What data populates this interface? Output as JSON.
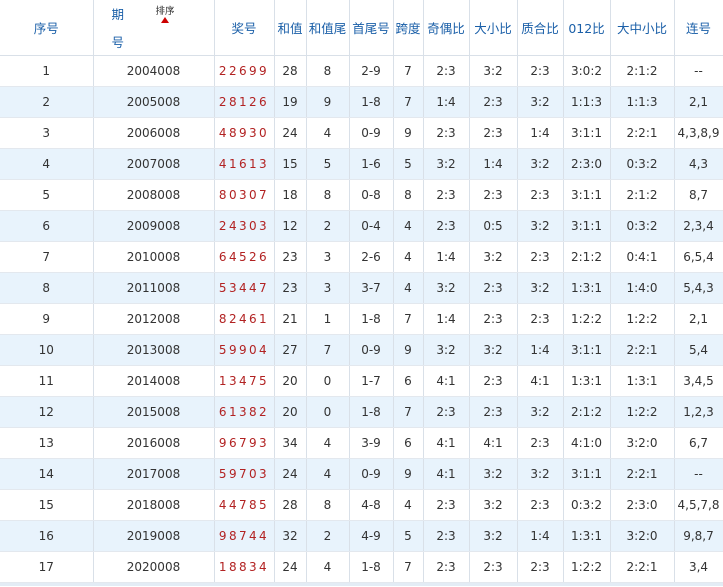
{
  "headers": {
    "seq": "序号",
    "period_1": "期",
    "period_2": "号",
    "sort": "排序",
    "prize": "奖号",
    "sum": "和值",
    "sum_tail": "和值尾",
    "head_tail": "首尾号",
    "span": "跨度",
    "odd_even": "奇偶比",
    "big_small": "大小比",
    "prime_comp": "质合比",
    "r012": "012比",
    "big_mid_small": "大中小比",
    "consecutive": "连号"
  },
  "rows": [
    {
      "seq": "1",
      "period": "2004008",
      "prize": "22699",
      "sum": "28",
      "tail": "8",
      "ht": "2-9",
      "span": "7",
      "oe": "2:3",
      "bs": "3:2",
      "pc": "2:3",
      "r012": "3:0:2",
      "bms": "2:1:2",
      "cons": "--"
    },
    {
      "seq": "2",
      "period": "2005008",
      "prize": "28126",
      "sum": "19",
      "tail": "9",
      "ht": "1-8",
      "span": "7",
      "oe": "1:4",
      "bs": "2:3",
      "pc": "3:2",
      "r012": "1:1:3",
      "bms": "1:1:3",
      "cons": "2,1"
    },
    {
      "seq": "3",
      "period": "2006008",
      "prize": "48930",
      "sum": "24",
      "tail": "4",
      "ht": "0-9",
      "span": "9",
      "oe": "2:3",
      "bs": "2:3",
      "pc": "1:4",
      "r012": "3:1:1",
      "bms": "2:2:1",
      "cons": "4,3,8,9"
    },
    {
      "seq": "4",
      "period": "2007008",
      "prize": "41613",
      "sum": "15",
      "tail": "5",
      "ht": "1-6",
      "span": "5",
      "oe": "3:2",
      "bs": "1:4",
      "pc": "3:2",
      "r012": "2:3:0",
      "bms": "0:3:2",
      "cons": "4,3"
    },
    {
      "seq": "5",
      "period": "2008008",
      "prize": "80307",
      "sum": "18",
      "tail": "8",
      "ht": "0-8",
      "span": "8",
      "oe": "2:3",
      "bs": "2:3",
      "pc": "2:3",
      "r012": "3:1:1",
      "bms": "2:1:2",
      "cons": "8,7"
    },
    {
      "seq": "6",
      "period": "2009008",
      "prize": "24303",
      "sum": "12",
      "tail": "2",
      "ht": "0-4",
      "span": "4",
      "oe": "2:3",
      "bs": "0:5",
      "pc": "3:2",
      "r012": "3:1:1",
      "bms": "0:3:2",
      "cons": "2,3,4"
    },
    {
      "seq": "7",
      "period": "2010008",
      "prize": "64526",
      "sum": "23",
      "tail": "3",
      "ht": "2-6",
      "span": "4",
      "oe": "1:4",
      "bs": "3:2",
      "pc": "2:3",
      "r012": "2:1:2",
      "bms": "0:4:1",
      "cons": "6,5,4"
    },
    {
      "seq": "8",
      "period": "2011008",
      "prize": "53447",
      "sum": "23",
      "tail": "3",
      "ht": "3-7",
      "span": "4",
      "oe": "3:2",
      "bs": "2:3",
      "pc": "3:2",
      "r012": "1:3:1",
      "bms": "1:4:0",
      "cons": "5,4,3"
    },
    {
      "seq": "9",
      "period": "2012008",
      "prize": "82461",
      "sum": "21",
      "tail": "1",
      "ht": "1-8",
      "span": "7",
      "oe": "1:4",
      "bs": "2:3",
      "pc": "2:3",
      "r012": "1:2:2",
      "bms": "1:2:2",
      "cons": "2,1"
    },
    {
      "seq": "10",
      "period": "2013008",
      "prize": "59904",
      "sum": "27",
      "tail": "7",
      "ht": "0-9",
      "span": "9",
      "oe": "3:2",
      "bs": "3:2",
      "pc": "1:4",
      "r012": "3:1:1",
      "bms": "2:2:1",
      "cons": "5,4"
    },
    {
      "seq": "11",
      "period": "2014008",
      "prize": "13475",
      "sum": "20",
      "tail": "0",
      "ht": "1-7",
      "span": "6",
      "oe": "4:1",
      "bs": "2:3",
      "pc": "4:1",
      "r012": "1:3:1",
      "bms": "1:3:1",
      "cons": "3,4,5"
    },
    {
      "seq": "12",
      "period": "2015008",
      "prize": "61382",
      "sum": "20",
      "tail": "0",
      "ht": "1-8",
      "span": "7",
      "oe": "2:3",
      "bs": "2:3",
      "pc": "3:2",
      "r012": "2:1:2",
      "bms": "1:2:2",
      "cons": "1,2,3"
    },
    {
      "seq": "13",
      "period": "2016008",
      "prize": "96793",
      "sum": "34",
      "tail": "4",
      "ht": "3-9",
      "span": "6",
      "oe": "4:1",
      "bs": "4:1",
      "pc": "2:3",
      "r012": "4:1:0",
      "bms": "3:2:0",
      "cons": "6,7"
    },
    {
      "seq": "14",
      "period": "2017008",
      "prize": "59703",
      "sum": "24",
      "tail": "4",
      "ht": "0-9",
      "span": "9",
      "oe": "4:1",
      "bs": "3:2",
      "pc": "3:2",
      "r012": "3:1:1",
      "bms": "2:2:1",
      "cons": "--"
    },
    {
      "seq": "15",
      "period": "2018008",
      "prize": "44785",
      "sum": "28",
      "tail": "8",
      "ht": "4-8",
      "span": "4",
      "oe": "2:3",
      "bs": "3:2",
      "pc": "2:3",
      "r012": "0:3:2",
      "bms": "2:3:0",
      "cons": "4,5,7,8"
    },
    {
      "seq": "16",
      "period": "2019008",
      "prize": "98744",
      "sum": "32",
      "tail": "2",
      "ht": "4-9",
      "span": "5",
      "oe": "2:3",
      "bs": "3:2",
      "pc": "1:4",
      "r012": "1:3:1",
      "bms": "3:2:0",
      "cons": "9,8,7"
    },
    {
      "seq": "17",
      "period": "2020008",
      "prize": "18834",
      "sum": "24",
      "tail": "4",
      "ht": "1-8",
      "span": "7",
      "oe": "2:3",
      "bs": "2:3",
      "pc": "2:3",
      "r012": "1:2:2",
      "bms": "2:2:1",
      "cons": "3,4"
    }
  ]
}
